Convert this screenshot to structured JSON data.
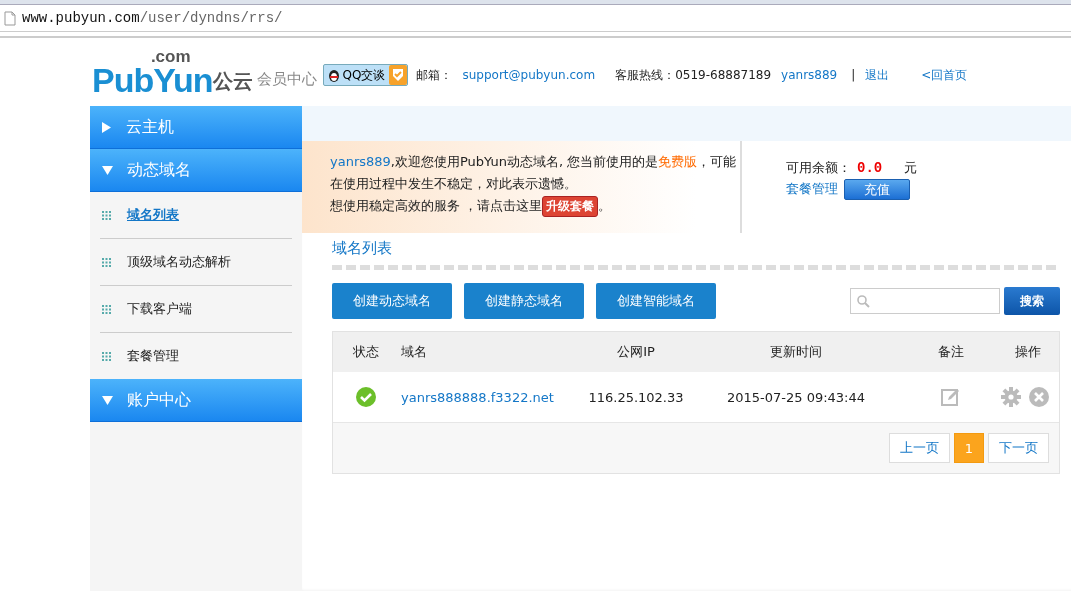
{
  "browser": {
    "url_host": "www.pubyun.com",
    "url_path": "/user/dyndns/rrs/"
  },
  "header": {
    "logo_domain": ".com",
    "logo_brand": "PubYun",
    "logo_cn": "公云",
    "subtitle": "会员中心",
    "qq_button": "QQ交谈",
    "email_label": "邮箱：",
    "email": "support@pubyun.com",
    "hotline": "客服热线：0519-68887189",
    "username": "yanrs889",
    "separator": "|",
    "logout": "退出",
    "home": "<回首页"
  },
  "sidebar": {
    "items": [
      {
        "label": "云主机",
        "expanded": false
      },
      {
        "label": "动态域名",
        "expanded": true,
        "children": [
          {
            "label": "域名列表",
            "selected": true
          },
          {
            "label": "顶级域名动态解析",
            "selected": false
          },
          {
            "label": "下载客户端",
            "selected": false
          },
          {
            "label": "套餐管理",
            "selected": false
          }
        ]
      },
      {
        "label": "账户中心",
        "expanded": true
      }
    ]
  },
  "notice": {
    "user": "yanrs889",
    "text_1": ",欢迎您使用PubYun动态域名, 您当前使用的是",
    "plan": "免费版",
    "text_2": "，可能在使用过程中发生不稳定，对此表示遗憾。",
    "text_3": "想使用稳定高效的服务 ，请点击这里",
    "upgrade_button": "升级套餐",
    "text_4": "。"
  },
  "balance": {
    "label": "可用余额：",
    "amount": "0.0",
    "unit": "元",
    "plan_link": "套餐管理",
    "recharge_button": "充值"
  },
  "section_title": "域名列表",
  "actions": [
    "创建动态域名",
    "创建静态域名",
    "创建智能域名"
  ],
  "search": {
    "button": "搜索"
  },
  "table": {
    "columns": [
      "状态",
      "域名",
      "公网IP",
      "更新时间",
      "备注",
      "操作"
    ],
    "rows": [
      {
        "ok": true,
        "domain": "yanrs888888.f3322.net",
        "ip": "116.25.102.33",
        "updated": "2015-07-25 09:43:44"
      }
    ]
  },
  "pagination": {
    "prev": "上一页",
    "next": "下一页",
    "pages": [
      {
        "label": "1",
        "selected": true
      }
    ]
  }
}
